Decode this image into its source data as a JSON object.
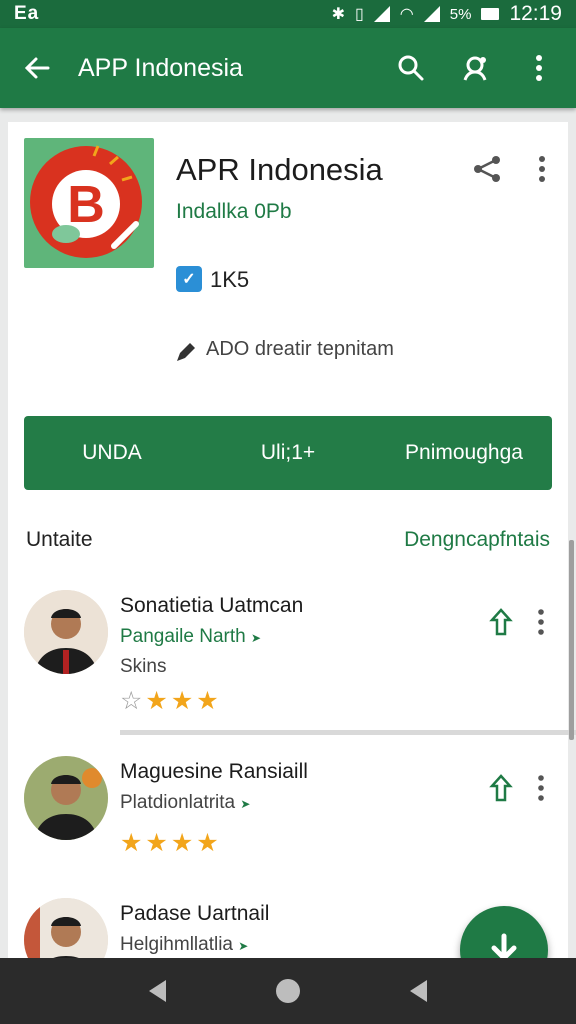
{
  "status_bar": {
    "left_label": "Ea",
    "battery_percent": "5%",
    "time": "12:19",
    "icons": [
      "bluetooth-icon",
      "vibrate-icon",
      "wifi-icon",
      "signal-icon",
      "battery-icon"
    ]
  },
  "app_bar": {
    "title": "APP Indonesia",
    "icons": [
      "back-arrow-icon",
      "search-icon",
      "account-icon",
      "more-vert-icon"
    ]
  },
  "app": {
    "name": "APR Indonesia",
    "developer": "Indallka 0Pb",
    "rating_label": "1K5",
    "rating_badge_glyph": "✓",
    "description": "ADO dreatir tepnitam",
    "icon_letter": "B",
    "icon_colors": {
      "background": "#5fb57a",
      "circle": "#d9321f",
      "letter": "#ffffff"
    }
  },
  "actions": [
    {
      "label": "UNDA"
    },
    {
      "label": "Uli;1+"
    },
    {
      "label": "Pnimoughga"
    }
  ],
  "reviews_section": {
    "title": "Untaite",
    "link": "Dengncapfntais"
  },
  "reviews": [
    {
      "name": "Sonatietia Uatmcan",
      "sub": "Pangaile Narth",
      "sub_arrow": "➤",
      "sub2": "Skins",
      "rating": 3,
      "max_rating": 4
    },
    {
      "name": "Maguesine Ransiaill",
      "sub": "Platdionlatrita",
      "sub_arrow": "➤",
      "sub2": "",
      "rating": 4,
      "max_rating": 4
    },
    {
      "name": "Padase Uartnail",
      "sub": "Helgihmllatlia",
      "sub_arrow": "➤",
      "sub2": "",
      "rating": 0,
      "max_rating": 0
    }
  ],
  "colors": {
    "primary": "#1f7a45",
    "status_bar": "#1b6b3d",
    "star": "#f2a51b",
    "fab": "#1f7a45"
  }
}
